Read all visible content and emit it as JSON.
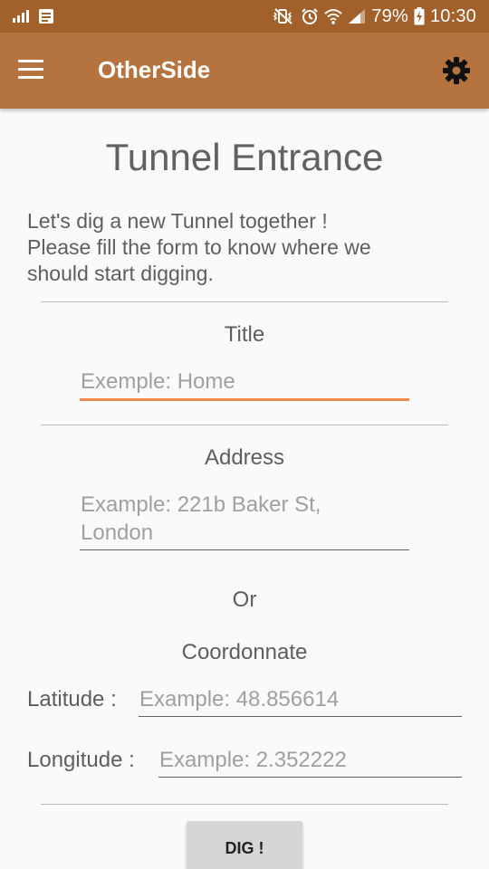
{
  "status_bar": {
    "battery_text": "79%",
    "time": "10:30",
    "icons": [
      "signal-bars-icon",
      "notes-icon",
      "mute-vibrate-icon",
      "alarm-icon",
      "wifi-icon",
      "cell-signal-icon",
      "battery-charging-icon"
    ]
  },
  "app_bar": {
    "title": "OtherSide",
    "menu_icon": "menu-icon",
    "settings_icon": "gear-icon",
    "color": "#b5743f"
  },
  "page": {
    "title": "Tunnel Entrance",
    "intro": "Let's dig a new Tunnel together !\nPlease fill the form to know where we\nshould start digging."
  },
  "form": {
    "title_label": "Title",
    "title_placeholder": "Exemple: Home",
    "address_label": "Address",
    "address_placeholder": "Example: 221b Baker St,\nLondon",
    "or_label": "Or",
    "coord_label": "Coordonnate",
    "latitude_label": "Latitude :",
    "latitude_placeholder": "Example: 48.856614",
    "longitude_label": "Longitude :",
    "longitude_placeholder": "Example: 2.352222",
    "dig_button": "DIG !",
    "accent_color": "#f08a4b"
  }
}
